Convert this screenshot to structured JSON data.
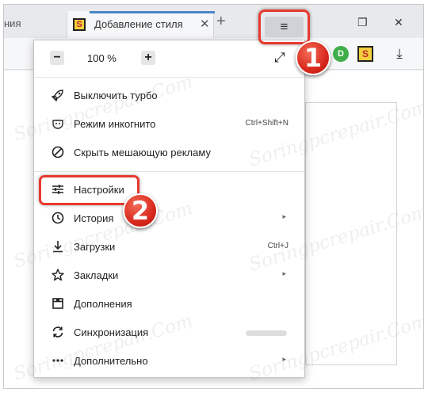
{
  "tabs": {
    "previous_partial": "ния",
    "active_title": "Добавление стиля",
    "close_glyph": "✕",
    "new_tab_glyph": "+"
  },
  "window": {
    "menu_glyph": "≡",
    "restore_glyph": "❐",
    "close_glyph": "✕"
  },
  "toolbar": {
    "extension_green_label": "D",
    "extension_s_label": "S",
    "download_glyph": "⤓"
  },
  "menu": {
    "zoom": {
      "minus": "−",
      "value": "100 %",
      "plus": "+"
    },
    "fullscreen_glyph": "⤢",
    "items": [
      {
        "label": "Выключить турбо",
        "icon": "rocket-icon",
        "glyph": "🚀"
      },
      {
        "label": "Режим инкогнито",
        "icon": "incognito-icon",
        "glyph": "◡",
        "shortcut": "Ctrl+Shift+N"
      },
      {
        "label": "Скрыть мешающую рекламу",
        "icon": "block-icon",
        "glyph": "⊘"
      },
      {
        "label": "Настройки",
        "icon": "settings-sliders-icon",
        "glyph": "☰"
      },
      {
        "label": "История",
        "icon": "history-clock-icon",
        "glyph": "◷",
        "submenu": "▸"
      },
      {
        "label": "Загрузки",
        "icon": "download-icon",
        "glyph": "⤓",
        "shortcut": "Ctrl+J"
      },
      {
        "label": "Закладки",
        "icon": "bookmark-star-icon",
        "glyph": "☆",
        "submenu": "▸"
      },
      {
        "label": "Дополнения",
        "icon": "addons-icon",
        "glyph": "⊡"
      },
      {
        "label": "Синхронизация",
        "icon": "sync-icon",
        "glyph": "⟲"
      },
      {
        "label": "Дополнительно",
        "icon": "more-icon",
        "glyph": "⋯",
        "submenu": "▸"
      }
    ]
  },
  "annotations": {
    "step1": "1",
    "step2": "2"
  },
  "watermark": "Soringpcrepair.Com",
  "colors": {
    "highlight": "#e8392f",
    "tab_accent": "#4b86c5"
  }
}
